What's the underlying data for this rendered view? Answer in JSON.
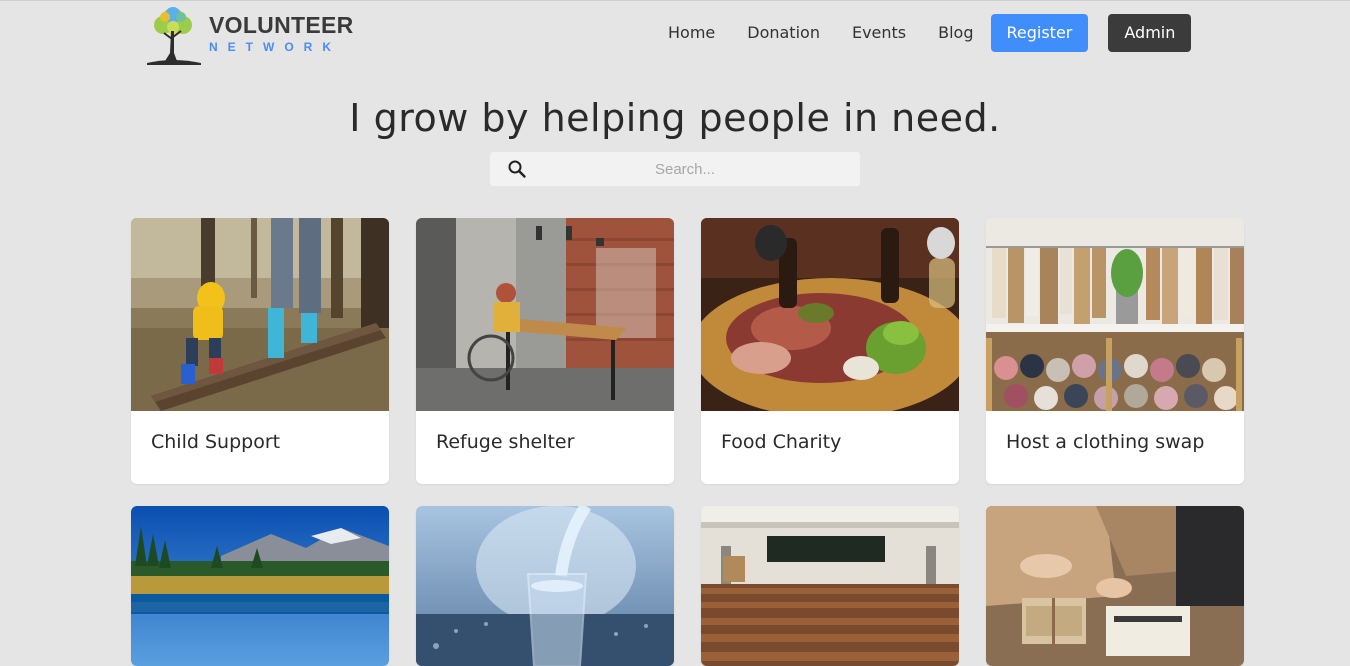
{
  "brand": {
    "line1": "VOLUNTEER",
    "line2": "NETWORK",
    "logo_icon": "tree-icon",
    "accent_color": "#4a8df0"
  },
  "nav": {
    "links": [
      "Home",
      "Donation",
      "Events",
      "Blog"
    ],
    "register_label": "Register",
    "admin_label": "Admin",
    "register_color": "#3f8efc",
    "admin_color": "#3b3b3b"
  },
  "hero": {
    "title": "I grow by helping people in need."
  },
  "search": {
    "placeholder": "Search...",
    "value": "",
    "icon": "search-icon"
  },
  "events": [
    {
      "title": "Child Support",
      "image": "child-walking-on-log-photo"
    },
    {
      "title": "Refuge shelter",
      "image": "woman-in-wheelchair-at-desk-photo"
    },
    {
      "title": "Food Charity",
      "image": "food-platter-photo"
    },
    {
      "title": "Host a clothing swap",
      "image": "clothing-rack-and-fabric-rolls-photo"
    },
    {
      "title": "",
      "image": "mountain-lake-landscape-photo"
    },
    {
      "title": "",
      "image": "water-pouring-into-glass-photo"
    },
    {
      "title": "",
      "image": "empty-lecture-hall-photo"
    },
    {
      "title": "",
      "image": "packing-books-box-photo"
    }
  ]
}
